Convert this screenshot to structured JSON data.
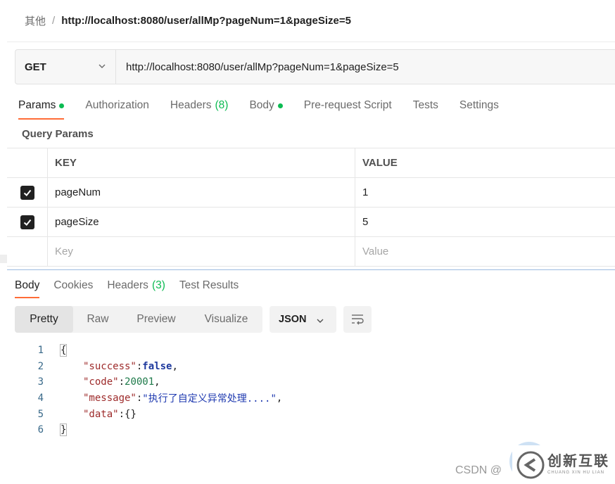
{
  "breadcrumb": {
    "parent": "其他",
    "separator": "/",
    "current": "http://localhost:8080/user/allMp?pageNum=1&pageSize=5"
  },
  "request": {
    "method": "GET",
    "url": "http://localhost:8080/user/allMp?pageNum=1&pageSize=5"
  },
  "tabs": {
    "params": "Params",
    "authorization": "Authorization",
    "headers": "Headers",
    "headers_count": "(8)",
    "body": "Body",
    "prerequest": "Pre-request Script",
    "tests": "Tests",
    "settings": "Settings"
  },
  "query_params": {
    "title": "Query Params",
    "key_header": "KEY",
    "value_header": "VALUE",
    "rows": [
      {
        "key": "pageNum",
        "value": "1",
        "checked": true
      },
      {
        "key": "pageSize",
        "value": "5",
        "checked": true
      }
    ],
    "key_placeholder": "Key",
    "value_placeholder": "Value"
  },
  "response_tabs": {
    "body": "Body",
    "cookies": "Cookies",
    "headers": "Headers",
    "headers_count": "(3)",
    "test_results": "Test Results"
  },
  "view_modes": {
    "pretty": "Pretty",
    "raw": "Raw",
    "preview": "Preview",
    "visualize": "Visualize"
  },
  "format": "JSON",
  "response": {
    "lines": [
      "1",
      "2",
      "3",
      "4",
      "5",
      "6"
    ],
    "open_brace": "{",
    "close_brace": "}",
    "success_key": "\"success\"",
    "success_val": "false",
    "code_key": "\"code\"",
    "code_val": "20001",
    "message_key": "\"message\"",
    "message_val": "\"执行了自定义异常处理....\"",
    "data_key": "\"data\"",
    "data_val": "{}"
  },
  "watermark": {
    "csdn": "CSDN @",
    "brand_cn": "创新互联",
    "brand_en": "CHUANG XIN HU LIAN"
  },
  "colors": {
    "accent": "#ff6c37",
    "success": "#0cbb52"
  }
}
